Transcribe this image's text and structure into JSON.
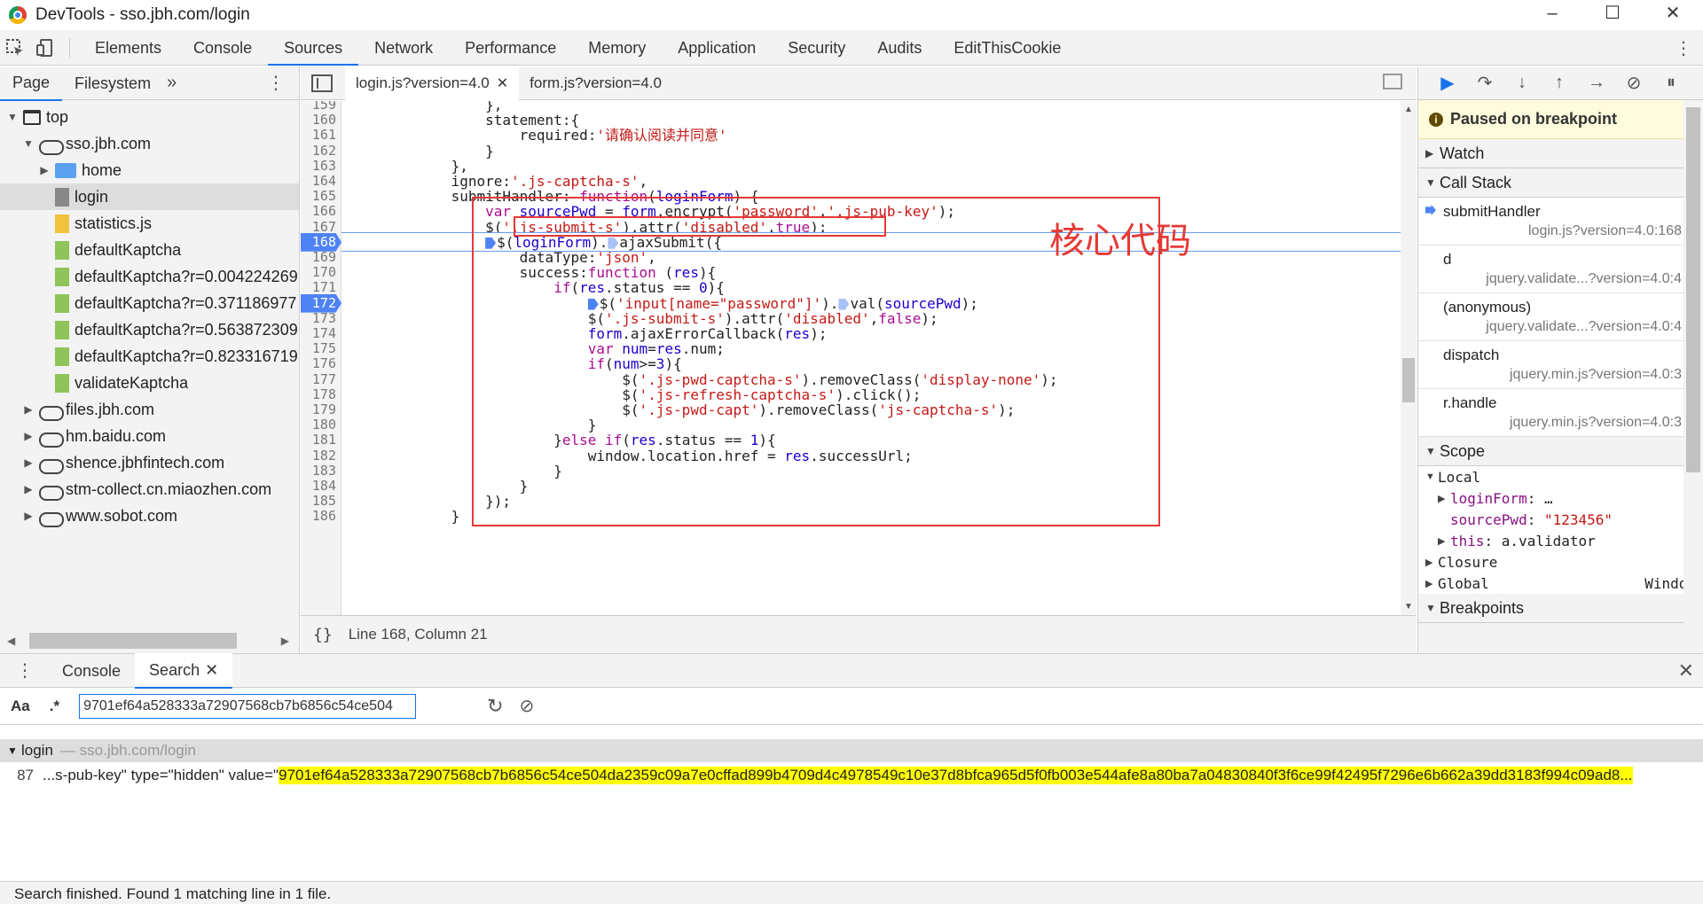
{
  "window": {
    "title": "DevTools - sso.jbh.com/login",
    "buttons": [
      "–",
      "☐",
      "✕"
    ]
  },
  "main_tabs": [
    "Elements",
    "Console",
    "Sources",
    "Network",
    "Performance",
    "Memory",
    "Application",
    "Security",
    "Audits",
    "EditThisCookie"
  ],
  "active_main_tab": "Sources",
  "navigator": {
    "tabs": [
      "Page",
      "Filesystem"
    ],
    "more": "»",
    "tree": [
      {
        "label": "top",
        "icon": "window-icon",
        "level": 0,
        "expanded": true
      },
      {
        "label": "sso.jbh.com",
        "icon": "cloud-icon",
        "level": 1,
        "expanded": true
      },
      {
        "label": "home",
        "icon": "folder-icon",
        "level": 2,
        "expanded": false
      },
      {
        "label": "login",
        "icon": "file-grey-icon",
        "level": 2,
        "selected": true
      },
      {
        "label": "statistics.js",
        "icon": "file-yellow-icon",
        "level": 2
      },
      {
        "label": "defaultKaptcha",
        "icon": "file-green-icon",
        "level": 2
      },
      {
        "label": "defaultKaptcha?r=0.004224269",
        "icon": "file-green-icon",
        "level": 2
      },
      {
        "label": "defaultKaptcha?r=0.371186977",
        "icon": "file-green-icon",
        "level": 2
      },
      {
        "label": "defaultKaptcha?r=0.563872309",
        "icon": "file-green-icon",
        "level": 2
      },
      {
        "label": "defaultKaptcha?r=0.823316719",
        "icon": "file-green-icon",
        "level": 2
      },
      {
        "label": "validateKaptcha",
        "icon": "file-green-icon",
        "level": 2
      },
      {
        "label": "files.jbh.com",
        "icon": "cloud-icon",
        "level": 1,
        "expanded": false
      },
      {
        "label": "hm.baidu.com",
        "icon": "cloud-icon",
        "level": 1,
        "expanded": false
      },
      {
        "label": "shence.jbhfintech.com",
        "icon": "cloud-icon",
        "level": 1,
        "expanded": false
      },
      {
        "label": "stm-collect.cn.miaozhen.com",
        "icon": "cloud-icon",
        "level": 1,
        "expanded": false
      },
      {
        "label": "www.sobot.com",
        "icon": "cloud-icon",
        "level": 1,
        "expanded": false
      }
    ]
  },
  "editor": {
    "tabs": [
      {
        "label": "login.js?version=4.0",
        "active": true,
        "closable": true
      },
      {
        "label": "form.js?version=4.0",
        "active": false
      }
    ],
    "breakpoint_lines": [
      168,
      172
    ],
    "execution_line": 168,
    "lines": [
      {
        "n": "159",
        "html": "                },"
      },
      {
        "n": "160",
        "html": "                statement:{"
      },
      {
        "n": "161",
        "html": "                    required:<span class=\"str\">'请确认阅读并同意'</span>"
      },
      {
        "n": "162",
        "html": "                }"
      },
      {
        "n": "163",
        "html": "            },"
      },
      {
        "n": "164",
        "html": "            ignore:<span class=\"str\">'.js-captcha-s'</span>,"
      },
      {
        "n": "165",
        "html": "            submitHandler: <span class=\"kw\">function</span>(<span class=\"blue\">loginForm</span>) {"
      },
      {
        "n": "166",
        "html": "                <span class=\"kw\">var</span> <span class=\"blue\">sourcePwd</span> = <span class=\"blue\">form</span>.encrypt(<span class=\"str\">'password'</span>,<span class=\"str\">'.js-pub-key'</span>);"
      },
      {
        "n": "167",
        "html": "                $(<span class=\"str\">'.js-submit-s'</span>).attr(<span class=\"str\">'disabled'</span>,<span class=\"kw\">true</span>);"
      },
      {
        "n": "168",
        "html": "                <span class=\"stepmark\"></span>$(<span class=\"blue\">loginForm</span>).<span class=\"stepmark light\"></span>ajaxSubmit({"
      },
      {
        "n": "169",
        "html": "                    dataType:<span class=\"str\">'json'</span>,"
      },
      {
        "n": "170",
        "html": "                    success:<span class=\"kw\">function</span> (<span class=\"blue\">res</span>){"
      },
      {
        "n": "171",
        "html": "                        <span class=\"kw\">if</span>(<span class=\"blue\">res</span>.status == <span class=\"blue\">0</span>){"
      },
      {
        "n": "172",
        "html": "                            <span class=\"stepmark\"></span>$(<span class=\"str\">'input[name=\"password\"]'</span>).<span class=\"stepmark light\"></span>val(<span class=\"blue\">sourcePwd</span>);"
      },
      {
        "n": "173",
        "html": "                            $(<span class=\"str\">'.js-submit-s'</span>).attr(<span class=\"str\">'disabled'</span>,<span class=\"kw\">false</span>);"
      },
      {
        "n": "174",
        "html": "                            <span class=\"blue\">form</span>.ajaxErrorCallback(<span class=\"blue\">res</span>);"
      },
      {
        "n": "175",
        "html": "                            <span class=\"kw\">var</span> <span class=\"blue\">num</span>=<span class=\"blue\">res</span>.num;"
      },
      {
        "n": "176",
        "html": "                            <span class=\"kw\">if</span>(<span class=\"blue\">num</span>&gt;=<span class=\"blue\">3</span>){"
      },
      {
        "n": "177",
        "html": "                                $(<span class=\"str\">'.js-pwd-captcha-s'</span>).removeClass(<span class=\"str\">'display-none'</span>);"
      },
      {
        "n": "178",
        "html": "                                $(<span class=\"str\">'.js-refresh-captcha-s'</span>).click();"
      },
      {
        "n": "179",
        "html": "                                $(<span class=\"str\">'.js-pwd-capt'</span>).removeClass(<span class=\"str\">'js-captcha-s'</span>);"
      },
      {
        "n": "180",
        "html": "                            }"
      },
      {
        "n": "181",
        "html": "                        }<span class=\"kw\">else</span> <span class=\"kw\">if</span>(<span class=\"blue\">res</span>.status == <span class=\"blue\">1</span>){"
      },
      {
        "n": "182",
        "html": "                            window.location.href = <span class=\"blue\">res</span>.successUrl;"
      },
      {
        "n": "183",
        "html": "                        }"
      },
      {
        "n": "184",
        "html": "                    }"
      },
      {
        "n": "185",
        "html": "                });"
      },
      {
        "n": "186",
        "html": "            }"
      }
    ],
    "annotation": "核心代码",
    "status": "Line 168, Column 21"
  },
  "debugger": {
    "paused_message": "Paused on breakpoint",
    "watch_label": "Watch",
    "call_stack_label": "Call Stack",
    "frames": [
      {
        "fn": "submitHandler",
        "loc": "login.js?version=4.0:168",
        "current": true
      },
      {
        "fn": "d",
        "loc": "jquery.validate...?version=4.0:4"
      },
      {
        "fn": "(anonymous)",
        "loc": "jquery.validate...?version=4.0:4"
      },
      {
        "fn": "dispatch",
        "loc": "jquery.min.js?version=4.0:3"
      },
      {
        "fn": "r.handle",
        "loc": "jquery.min.js?version=4.0:3"
      }
    ],
    "scope_label": "Scope",
    "local_label": "Local",
    "scope_vars": [
      {
        "name": "loginForm",
        "sep": ": ",
        "value": "…",
        "expandable": true
      },
      {
        "name": "sourcePwd",
        "sep": ": ",
        "value": "\"123456\"",
        "expandable": false,
        "is_string": true
      },
      {
        "name": "this",
        "sep": ": ",
        "value": "a.validator",
        "expandable": true
      }
    ],
    "closure_label": "Closure",
    "global_label": "Global",
    "global_value": "Window",
    "breakpoints_label": "Breakpoints"
  },
  "drawer": {
    "tabs": [
      "Console",
      "Search"
    ],
    "active_tab": "Search",
    "match_case_label": "Aa",
    "regex_label": ".*",
    "search_query": "9701ef64a528333a72907568cb7b6856c54ce504",
    "result_file": "login",
    "result_url": "— sso.jbh.com/login",
    "result_line_number": "87",
    "result_prefix": "...s-pub-key\" type=\"hidden\" value=\"",
    "result_highlight": "9701ef64a528333a72907568cb7b6856c54ce504da2359c09a7e0cffad899b4709d4c4978549c10e37d8bfca965d5f0fb003e544afe8a80ba7a04830840f3f6ce99f42495f7296e6b662a39dd3183f994c09ad8...",
    "footer": "Search finished.  Found 1 matching line in 1 file."
  }
}
